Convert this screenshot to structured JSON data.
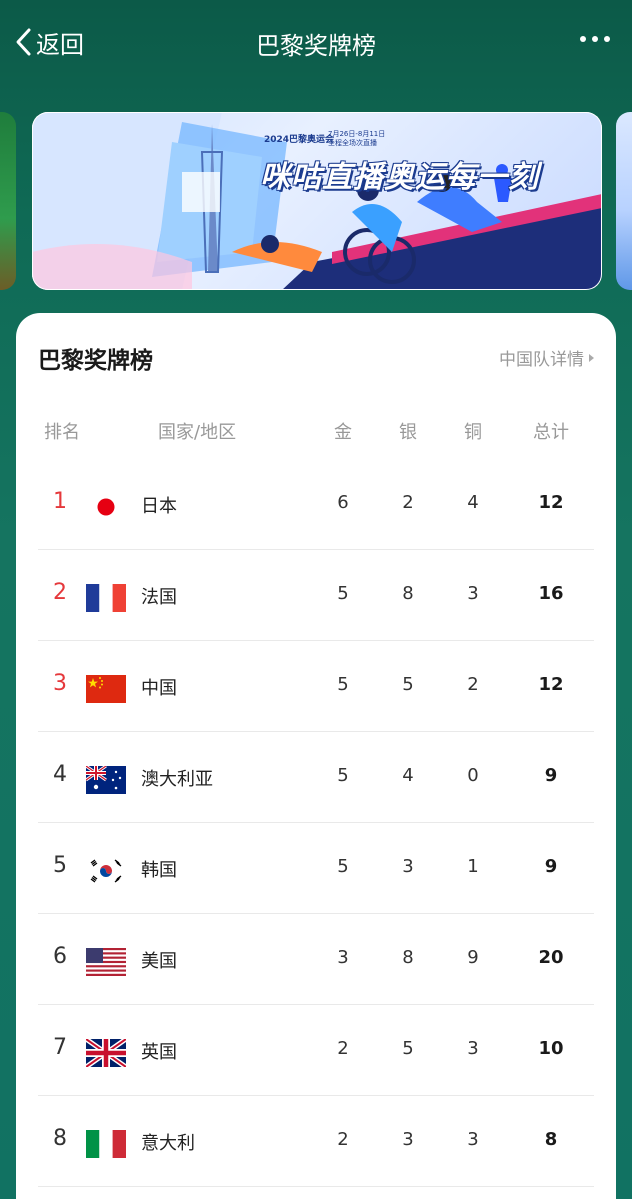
{
  "nav": {
    "back_label": "返回",
    "title": "巴黎奖牌榜"
  },
  "banner": {
    "caption": "2024巴黎奥运会",
    "dates": "7月26日-8月11日\n全程全场次直播",
    "slogan": "咪咕直播奥运每一刻"
  },
  "card": {
    "title": "巴黎奖牌榜",
    "detail_link": "中国队详情",
    "headers": {
      "rank": "排名",
      "country": "国家/地区",
      "gold": "金",
      "silver": "银",
      "bronze": "铜",
      "total": "总计"
    },
    "rows": [
      {
        "rank": "1",
        "flag": "japan-flag",
        "country": "日本",
        "gold": "6",
        "silver": "2",
        "bronze": "4",
        "total": "12"
      },
      {
        "rank": "2",
        "flag": "france-flag",
        "country": "法国",
        "gold": "5",
        "silver": "8",
        "bronze": "3",
        "total": "16"
      },
      {
        "rank": "3",
        "flag": "china-flag",
        "country": "中国",
        "gold": "5",
        "silver": "5",
        "bronze": "2",
        "total": "12"
      },
      {
        "rank": "4",
        "flag": "australia-flag",
        "country": "澳大利亚",
        "gold": "5",
        "silver": "4",
        "bronze": "0",
        "total": "9"
      },
      {
        "rank": "5",
        "flag": "korea-flag",
        "country": "韩国",
        "gold": "5",
        "silver": "3",
        "bronze": "1",
        "total": "9"
      },
      {
        "rank": "6",
        "flag": "usa-flag",
        "country": "美国",
        "gold": "3",
        "silver": "8",
        "bronze": "9",
        "total": "20"
      },
      {
        "rank": "7",
        "flag": "uk-flag",
        "country": "英国",
        "gold": "2",
        "silver": "5",
        "bronze": "3",
        "total": "10"
      },
      {
        "rank": "8",
        "flag": "italy-flag",
        "country": "意大利",
        "gold": "2",
        "silver": "3",
        "bronze": "3",
        "total": "8"
      }
    ]
  },
  "colors": {
    "header_bg": "#0f6a55",
    "top_rank": "#e5383b",
    "card_bg": "#ffffff"
  }
}
